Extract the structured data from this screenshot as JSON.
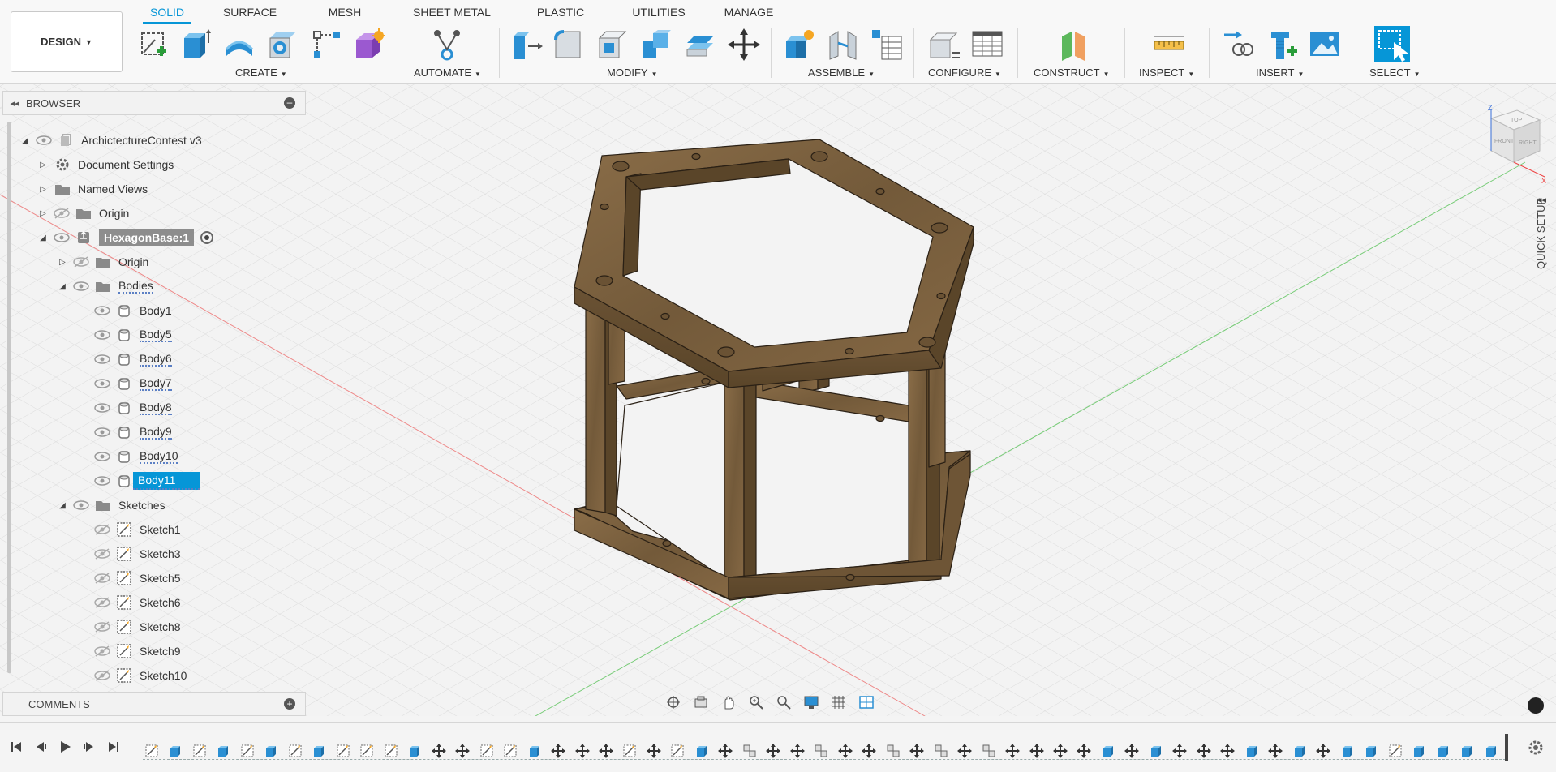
{
  "app": {
    "workspace_label": "DESIGN"
  },
  "toolbar": {
    "tabs": [
      {
        "label": "SOLID",
        "active": true
      },
      {
        "label": "SURFACE",
        "active": false
      },
      {
        "label": "MESH",
        "active": false
      },
      {
        "label": "SHEET METAL",
        "active": false
      },
      {
        "label": "PLASTIC",
        "active": false
      },
      {
        "label": "UTILITIES",
        "active": false
      },
      {
        "label": "MANAGE",
        "active": false
      }
    ],
    "groups": [
      {
        "label": "CREATE",
        "icons": [
          "new-sketch-icon",
          "extrude-icon",
          "revolve-icon",
          "hole-icon",
          "pattern-icon",
          "form-icon"
        ]
      },
      {
        "label": "AUTOMATE",
        "icons": [
          "automate-icon"
        ]
      },
      {
        "label": "MODIFY",
        "icons": [
          "press-pull-icon",
          "fillet-icon",
          "shell-icon",
          "combine-icon",
          "offset-face-icon",
          "move-icon"
        ]
      },
      {
        "label": "ASSEMBLE",
        "icons": [
          "new-component-icon",
          "joint-icon",
          "bom-icon"
        ]
      },
      {
        "label": "CONFIGURE",
        "icons": [
          "configure-icon",
          "config-table-icon"
        ]
      },
      {
        "label": "CONSTRUCT",
        "icons": [
          "plane-icon"
        ]
      },
      {
        "label": "INSPECT",
        "icons": [
          "measure-icon"
        ]
      },
      {
        "label": "INSERT",
        "icons": [
          "insert-derive-icon",
          "insert-mcmaster-icon",
          "insert-image-icon"
        ]
      },
      {
        "label": "SELECT",
        "icons": [
          "select-icon"
        ]
      }
    ],
    "accent_color": "#0696d7"
  },
  "browser": {
    "title": "BROWSER",
    "items": [
      {
        "label": "ArchictectureContest v3",
        "depth": 0,
        "expanded": true,
        "icon": "document-icon",
        "visible": true
      },
      {
        "label": "Document Settings",
        "depth": 1,
        "expanded": false,
        "icon": "gear-icon"
      },
      {
        "label": "Named Views",
        "depth": 1,
        "expanded": false,
        "icon": "folder-icon"
      },
      {
        "label": "Origin",
        "depth": 1,
        "expanded": false,
        "icon": "folder-icon",
        "visible": false
      },
      {
        "label": "HexagonBase:1",
        "depth": 1,
        "expanded": true,
        "icon": "component-icon",
        "visible": true,
        "active": true
      },
      {
        "label": "Origin",
        "depth": 2,
        "expanded": false,
        "icon": "folder-icon",
        "visible": false
      },
      {
        "label": "Bodies",
        "depth": 2,
        "expanded": true,
        "icon": "folder-icon",
        "visible": true
      },
      {
        "label": "Body1",
        "depth": 3,
        "icon": "body-icon",
        "visible": true
      },
      {
        "label": "Body5",
        "depth": 3,
        "icon": "body-icon",
        "visible": true
      },
      {
        "label": "Body6",
        "depth": 3,
        "icon": "body-icon",
        "visible": true
      },
      {
        "label": "Body7",
        "depth": 3,
        "icon": "body-icon",
        "visible": true
      },
      {
        "label": "Body8",
        "depth": 3,
        "icon": "body-icon",
        "visible": true
      },
      {
        "label": "Body9",
        "depth": 3,
        "icon": "body-icon",
        "visible": true
      },
      {
        "label": "Body10",
        "depth": 3,
        "icon": "body-icon",
        "visible": true
      },
      {
        "label": "Body11",
        "depth": 3,
        "icon": "body-icon",
        "visible": true,
        "selected": true
      },
      {
        "label": "Sketches",
        "depth": 2,
        "expanded": true,
        "icon": "folder-icon",
        "visible": true
      },
      {
        "label": "Sketch1",
        "depth": 3,
        "icon": "sketch-icon",
        "visible": false
      },
      {
        "label": "Sketch3",
        "depth": 3,
        "icon": "sketch-icon",
        "visible": false
      },
      {
        "label": "Sketch5",
        "depth": 3,
        "icon": "sketch-icon",
        "visible": false
      },
      {
        "label": "Sketch6",
        "depth": 3,
        "icon": "sketch-icon",
        "visible": false
      },
      {
        "label": "Sketch8",
        "depth": 3,
        "icon": "sketch-icon",
        "visible": false
      },
      {
        "label": "Sketch9",
        "depth": 3,
        "icon": "sketch-icon",
        "visible": false
      },
      {
        "label": "Sketch10",
        "depth": 3,
        "icon": "sketch-icon",
        "visible": false
      }
    ]
  },
  "comments": {
    "title": "COMMENTS"
  },
  "right_panel": {
    "quick_setup_label": "QUICK SETUP"
  },
  "viewcube": {
    "faces": [
      "TOP",
      "FRONT",
      "RIGHT"
    ],
    "axes": [
      "Z",
      "X"
    ]
  },
  "navbar": {
    "icons": [
      "orbit-icon",
      "look-at-icon",
      "pan-icon",
      "zoom-window-icon",
      "zoom-icon",
      "display-settings-icon",
      "grid-icon",
      "viewports-icon"
    ]
  },
  "timeline": {
    "controls": [
      "go-to-start-icon",
      "step-back-icon",
      "play-icon",
      "step-forward-icon",
      "go-to-end-icon"
    ],
    "features": [
      "sketch",
      "extrude",
      "sketch",
      "extrude",
      "sketch",
      "extrude",
      "sketch",
      "extrude",
      "sketch",
      "sketch",
      "sketch",
      "extrude",
      "move",
      "move",
      "sketch",
      "sketch",
      "extrude",
      "move",
      "move",
      "move",
      "sketch",
      "move",
      "sketch",
      "extrude",
      "move",
      "joint",
      "move",
      "move",
      "joint",
      "move",
      "move",
      "joint",
      "move",
      "joint",
      "move",
      "joint",
      "move",
      "move",
      "move",
      "move",
      "extrude",
      "move",
      "extrude",
      "move",
      "move",
      "move",
      "extrude",
      "move",
      "extrude",
      "move",
      "extrude",
      "extrude",
      "sketch",
      "extrude",
      "extrude",
      "extrude",
      "extrude"
    ]
  },
  "model": {
    "wood_color": "#7e6442",
    "name": "HexagonBase"
  }
}
